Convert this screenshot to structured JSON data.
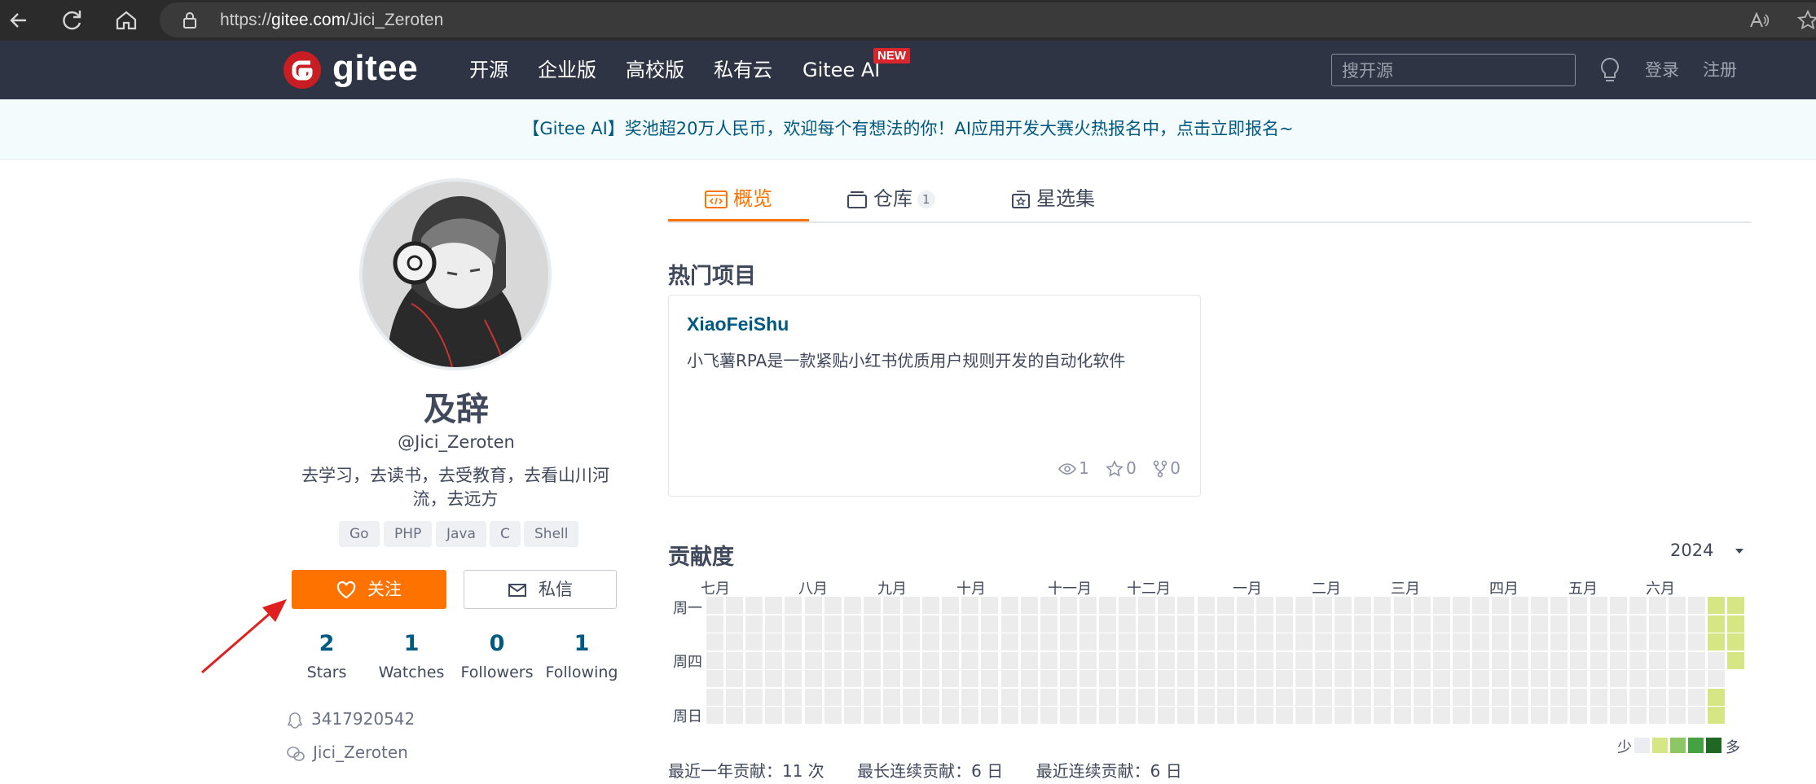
{
  "browser": {
    "url_prefix": "https://",
    "url_domain": "gitee.com",
    "url_path": "/Jici_Zeroten"
  },
  "header": {
    "logo_text": "gitee",
    "nav": [
      "开源",
      "企业版",
      "高校版",
      "私有云",
      "Gitee AI"
    ],
    "new_badge": "NEW",
    "search_placeholder": "搜开源",
    "login": "登录",
    "register": "注册"
  },
  "banner": {
    "text": "【Gitee AI】奖池超20万人民币，欢迎每个有想法的你！AI应用开发大赛火热报名中，点击立即报名~"
  },
  "profile": {
    "display_name": "及辞",
    "username": "@Jici_Zeroten",
    "bio": "去学习，去读书，去受教育，去看山川河流，去远方",
    "languages": [
      "Go",
      "PHP",
      "Java",
      "C",
      "Shell"
    ],
    "follow_label": "关注",
    "message_label": "私信",
    "stats": [
      {
        "count": "2",
        "label": "Stars"
      },
      {
        "count": "1",
        "label": "Watches"
      },
      {
        "count": "0",
        "label": "Followers"
      },
      {
        "count": "1",
        "label": "Following"
      }
    ],
    "qq": "3417920542",
    "wechat": "Jici_Zeroten"
  },
  "tabs": {
    "overview": "概览",
    "repos": "仓库",
    "repo_count": "1",
    "stars": "星选集"
  },
  "hot_projects": {
    "title": "热门项目",
    "project": {
      "name": "XiaoFeiShu",
      "description": "小飞薯RPA是一款紧贴小红书优质用户规则开发的自动化软件",
      "watches": "1",
      "stars": "0",
      "forks": "0"
    }
  },
  "contributions": {
    "title": "贡献度",
    "year": "2024",
    "months": [
      "七月",
      "八月",
      "九月",
      "十月",
      "十一月",
      "十二月",
      "一月",
      "二月",
      "三月",
      "四月",
      "五月",
      "六月"
    ],
    "days": [
      "周一",
      "周四",
      "周日"
    ],
    "legend_less": "少",
    "legend_more": "多",
    "legend_colors": [
      "#ebedf0",
      "#d6e685",
      "#8cc665",
      "#44a340",
      "#1e6823"
    ],
    "cell_empty": "#ececec",
    "cell_active": "#d6e685",
    "summary_year": "最近一年贡献：11 次",
    "summary_longest": "最长连续贡献：6 日",
    "summary_recent": "最近连续贡献：6 日"
  },
  "colors": {
    "brand_orange": "#fe7300",
    "header_bg": "#2e3443",
    "link_blue": "#005980"
  }
}
